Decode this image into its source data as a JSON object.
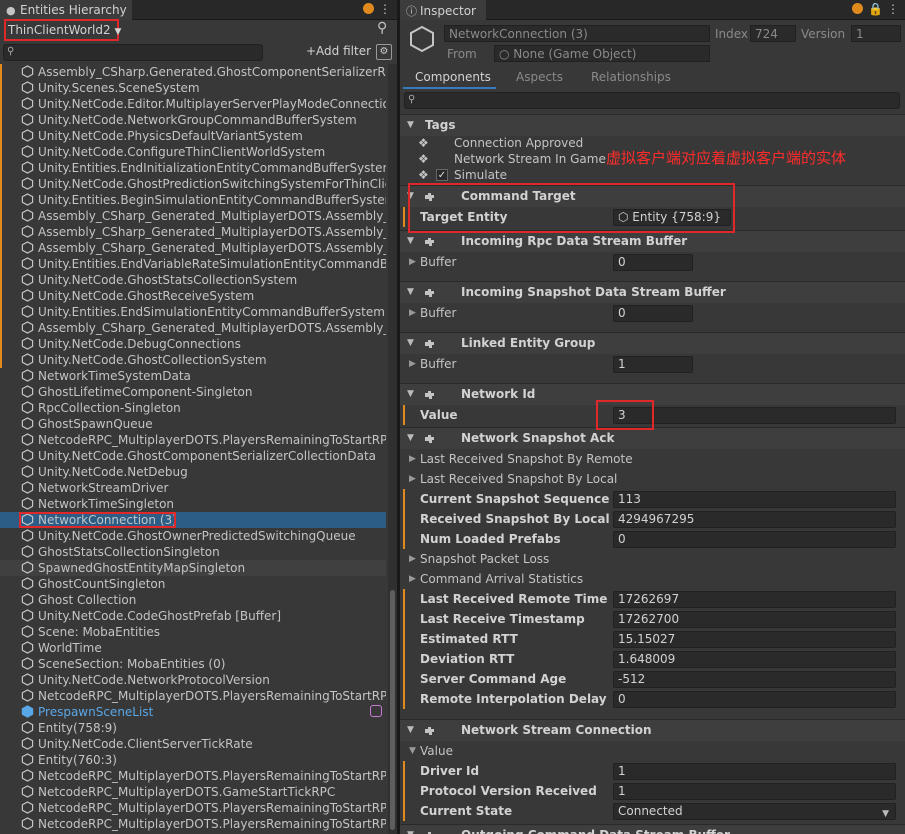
{
  "hierarchy": {
    "tab_title": "Entities Hierarchy",
    "world_selector": "ThinClientWorld2",
    "search_placeholder": "",
    "add_filter": "+Add filter",
    "items": [
      "Assembly_CSharp.Generated.GhostComponentSerializerRegi",
      "Unity.Scenes.SceneSystem",
      "Unity.NetCode.Editor.MultiplayerServerPlayModeConnectionS",
      "Unity.NetCode.NetworkGroupCommandBufferSystem",
      "Unity.NetCode.PhysicsDefaultVariantSystem",
      "Unity.NetCode.ConfigureThinClientWorldSystem",
      "Unity.Entities.EndInitializationEntityCommandBufferSystem",
      "Unity.NetCode.GhostPredictionSwitchingSystemForThinClien",
      "Unity.Entities.BeginSimulationEntityCommandBufferSystem",
      "Assembly_CSharp_Generated_MultiplayerDOTS.Assembly_CS",
      "Assembly_CSharp_Generated_MultiplayerDOTS.Assembly_CS",
      "Assembly_CSharp_Generated_MultiplayerDOTS.Assembly_CS",
      "Unity.Entities.EndVariableRateSimulationEntityCommandBuffe",
      "Unity.NetCode.GhostStatsCollectionSystem",
      "Unity.NetCode.GhostReceiveSystem",
      "Unity.Entities.EndSimulationEntityCommandBufferSystem",
      "Assembly_CSharp_Generated_MultiplayerDOTS.Assembly_CS",
      "Unity.NetCode.DebugConnections",
      "Unity.NetCode.GhostCollectionSystem",
      "NetworkTimeSystemData",
      "GhostLifetimeComponent-Singleton",
      "RpcCollection-Singleton",
      "GhostSpawnQueue",
      "NetcodeRPC_MultiplayerDOTS.PlayersRemainingToStartRPC",
      "Unity.NetCode.GhostComponentSerializerCollectionData",
      "Unity.NetCode.NetDebug",
      "NetworkStreamDriver",
      "NetworkTimeSingleton",
      "NetworkConnection (3)",
      "Unity.NetCode.GhostOwnerPredictedSwitchingQueue",
      "GhostStatsCollectionSingleton",
      "SpawnedGhostEntityMapSingleton",
      "GhostCountSingleton",
      "Ghost Collection",
      "Unity.NetCode.CodeGhostPrefab [Buffer]",
      "Scene: MobaEntities",
      "WorldTime",
      "SceneSection: MobaEntities (0)",
      "Unity.NetCode.NetworkProtocolVersion",
      "NetcodeRPC_MultiplayerDOTS.PlayersRemainingToStartRPC",
      "PrespawnSceneList",
      "Entity(758:9)",
      "Unity.NetCode.ClientServerTickRate",
      "Entity(760:3)",
      "NetcodeRPC_MultiplayerDOTS.PlayersRemainingToStartRPC",
      "NetcodeRPC_MultiplayerDOTS.GameStartTickRPC",
      "NetcodeRPC_MultiplayerDOTS.PlayersRemainingToStartRPC",
      "NetcodeRPC_MultiplayerDOTS.PlayersRemainingToStartRPC"
    ]
  },
  "inspector": {
    "tab_title": "Inspector",
    "entity_name": "NetworkConnection (3)",
    "index_label": "Index",
    "index_value": "724",
    "version_label": "Version",
    "version_value": "1",
    "from_label": "From",
    "from_value": "None (Game Object)",
    "tabs": [
      "Components",
      "Aspects",
      "Relationships"
    ],
    "tags_title": "Tags",
    "tags": [
      "Connection Approved",
      "Network Stream In Game",
      "Simulate"
    ],
    "annotation": "虚拟客户端对应着虚拟客户端的实体",
    "command_target": {
      "title": "Command Target",
      "label": "Target Entity",
      "value": "Entity {758:9}"
    },
    "rpc_buffer": {
      "title": "Incoming Rpc Data Stream Buffer",
      "label": "Buffer",
      "value": "0"
    },
    "snapshot_buffer": {
      "title": "Incoming Snapshot Data Stream Buffer",
      "label": "Buffer",
      "value": "0"
    },
    "linked_group": {
      "title": "Linked Entity Group",
      "label": "Buffer",
      "value": "1"
    },
    "network_id": {
      "title": "Network Id",
      "label": "Value",
      "value": "3"
    },
    "snapshot_ack": {
      "title": "Network Snapshot Ack",
      "fold1": "Last Received Snapshot By Remote",
      "fold2": "Last Received Snapshot By Local",
      "rows1": [
        {
          "label": "Current Snapshot Sequence Id",
          "value": "113"
        },
        {
          "label": "Received Snapshot By Local M...",
          "value": "4294967295"
        },
        {
          "label": "Num Loaded Prefabs",
          "value": "0"
        }
      ],
      "fold3": "Snapshot Packet Loss",
      "fold4": "Command Arrival Statistics",
      "rows2": [
        {
          "label": "Last Received Remote Time",
          "value": "17262697"
        },
        {
          "label": "Last Receive Timestamp",
          "value": "17262700"
        },
        {
          "label": "Estimated RTT",
          "value": "15.15027"
        },
        {
          "label": "Deviation RTT",
          "value": "1.648009"
        },
        {
          "label": "Server Command Age",
          "value": "-512"
        },
        {
          "label": "Remote Interpolation Delay",
          "value": "0"
        }
      ]
    },
    "stream_connection": {
      "title": "Network Stream Connection",
      "value_fold": "Value",
      "rows": [
        {
          "label": "Driver Id",
          "value": "1"
        },
        {
          "label": "Protocol Version Received",
          "value": "1"
        },
        {
          "label": "Current State",
          "value": "Connected"
        }
      ]
    },
    "next_title": "Outgoing Command Data Stream Buffer"
  },
  "colors": {
    "accent": "#2c5d87",
    "override": "#e08a1e",
    "highlight": "#e0272a"
  }
}
